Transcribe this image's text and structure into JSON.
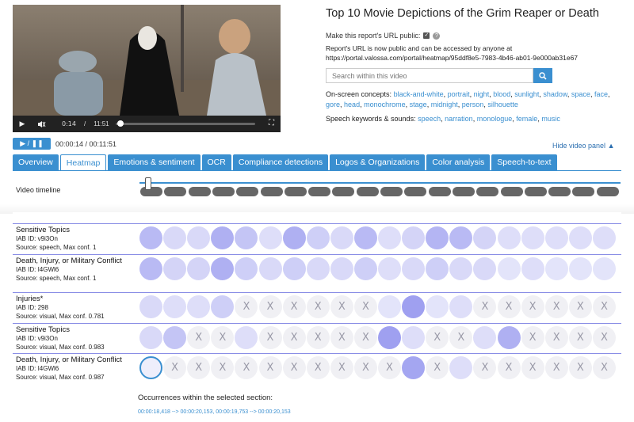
{
  "video": {
    "current_time": "0:14",
    "duration": "11:51"
  },
  "report": {
    "title": "Top 10 Movie Depictions of the Grim Reaper or Death",
    "public_label": "Make this report's URL public:",
    "public_note_1": "Report's URL is now public and can be accessed by anyone at",
    "public_note_2": "https://portal.valossa.com/portal/heatmap/95ddf8e5-7983-4b46-ab01-9e000ab31e67",
    "search_placeholder": "Search within this video",
    "concepts_label": "On-screen concepts:",
    "concepts": [
      "black-and-white",
      "portrait",
      "night",
      "blood",
      "sunlight",
      "shadow",
      "space",
      "face",
      "gore",
      "head",
      "monochrome",
      "stage",
      "midnight",
      "person",
      "silhouette"
    ],
    "speech_label": "Speech keywords & sounds:",
    "speech": [
      "speech",
      "narration",
      "monologue",
      "female",
      "music"
    ]
  },
  "player": {
    "play_label": "▶ / ❚❚",
    "time": "00:00:14 / 00:11:51",
    "hide_panel": "Hide video panel"
  },
  "tabs": [
    {
      "label": "Overview",
      "active": false
    },
    {
      "label": "Heatmap",
      "active": true
    },
    {
      "label": "Emotions & sentiment",
      "active": false
    },
    {
      "label": "OCR",
      "active": false
    },
    {
      "label": "Compliance detections",
      "active": false
    },
    {
      "label": "Logos & Organizations",
      "active": false
    },
    {
      "label": "Color analysis",
      "active": false
    },
    {
      "label": "Speech-to-text",
      "active": false
    }
  ],
  "timeline": {
    "label": "Video timeline",
    "segments": 20
  },
  "heatmap_rows": [
    {
      "name": "Sensitive Topics",
      "iab": "IAB ID: v9i3On",
      "source": "Source: speech, Max conf. 1",
      "cells": [
        0.5,
        0.2,
        0.2,
        0.6,
        0.4,
        0.15,
        0.6,
        0.3,
        0.2,
        0.5,
        0.15,
        0.25,
        0.55,
        0.5,
        0.25,
        0.15,
        0.15,
        0.15,
        0.15,
        0.15
      ]
    },
    {
      "name": "Death, Injury, or Military Conflict",
      "iab": "IAB ID: I4GWl6",
      "source": "Source: speech, Max conf. 1",
      "cells": [
        0.5,
        0.25,
        0.25,
        0.6,
        0.3,
        0.2,
        0.3,
        0.2,
        0.2,
        0.3,
        0.15,
        0.2,
        0.3,
        0.2,
        0.2,
        0.1,
        0.15,
        0.1,
        0.1,
        0.1
      ]
    },
    {
      "name": "Injuries*",
      "iab": "IAB ID: 298",
      "source": "Source: visual, Max conf. 0.781",
      "cells": [
        0.2,
        0.15,
        0.15,
        0.3,
        -1,
        -1,
        -1,
        -1,
        -1,
        -1,
        0.1,
        0.75,
        0.1,
        0.15,
        -1,
        -1,
        -1,
        -1,
        -1,
        -1
      ]
    },
    {
      "name": "Sensitive Topics",
      "iab": "IAB ID: v9i3On",
      "source": "Source: visual, Max conf. 0.983",
      "cells": [
        0.2,
        0.4,
        -1,
        -1,
        0.15,
        -1,
        -1,
        -1,
        -1,
        -1,
        0.75,
        0.15,
        -1,
        -1,
        0.15,
        0.6,
        -1,
        -1,
        -1,
        -1
      ]
    },
    {
      "name": "Death, Injury, or Military Conflict",
      "iab": "IAB ID: I4GWl6",
      "source": "Source: visual, Max conf. 0.987",
      "cells": [
        -2,
        -1,
        -1,
        -1,
        -1,
        -1,
        -1,
        -1,
        -1,
        -1,
        -1,
        0.7,
        -1,
        0.15,
        -1,
        -1,
        -1,
        -1,
        -1,
        -1
      ]
    }
  ],
  "occurrences": {
    "label": "Occurrences within the selected section:",
    "times": "00:00:18,418 --> 00:00:20,153,    00:00:19,753 --> 00:00:20,153"
  },
  "colors": {
    "accent": "#3a8fd0",
    "heat_strong": "#a8a8f2",
    "heat_weak": "#eeeefb",
    "empty_cell": "#f0f0f4"
  }
}
